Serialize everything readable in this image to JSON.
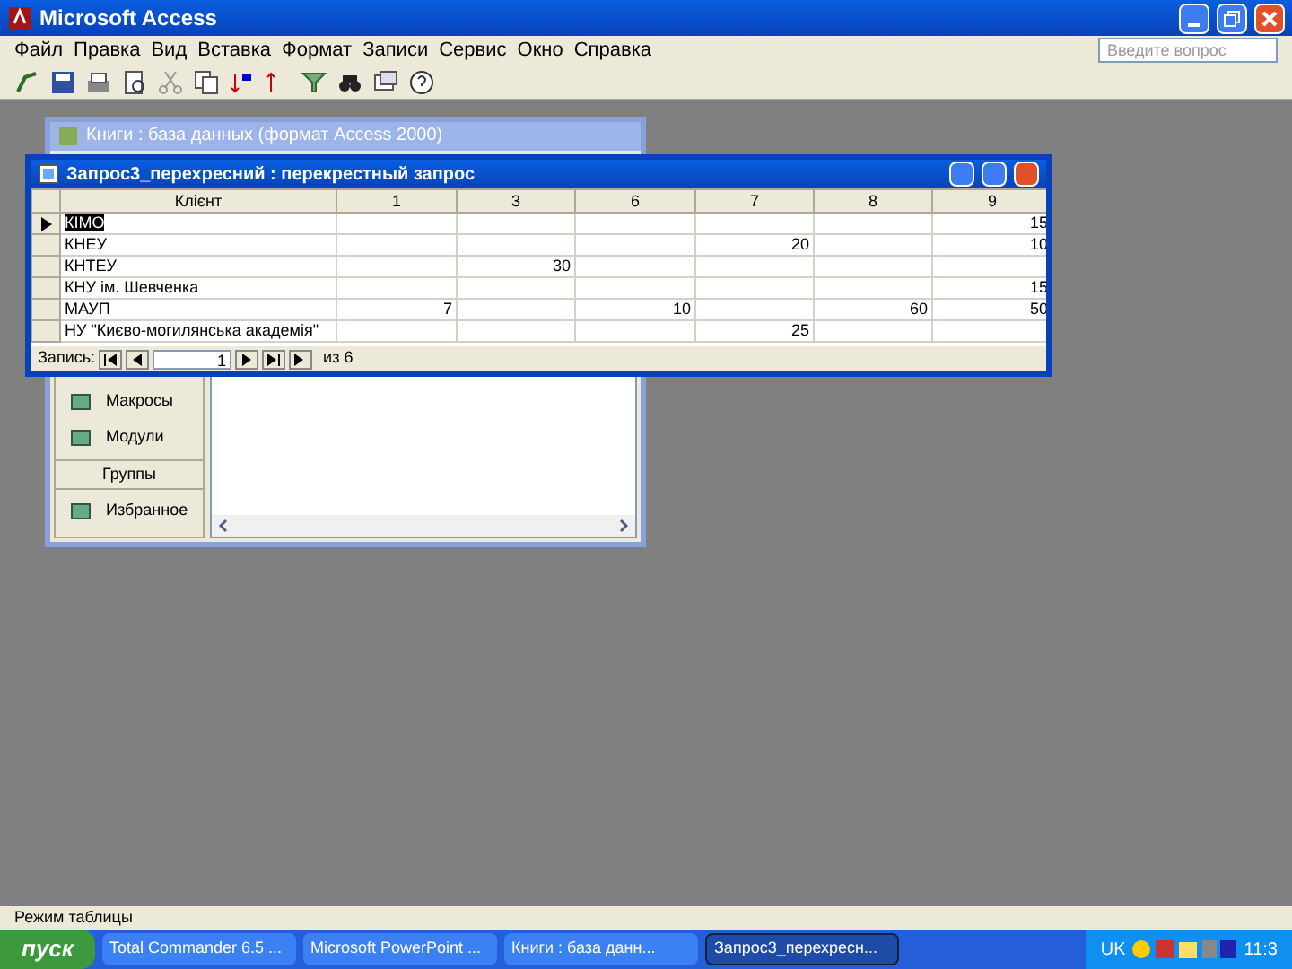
{
  "app_window": {
    "title": "Microsoft Access"
  },
  "menu": [
    {
      "label": "Файл"
    },
    {
      "label": "Правка"
    },
    {
      "label": "Вид"
    },
    {
      "label": "Вставка"
    },
    {
      "label": "Формат"
    },
    {
      "label": "Записи"
    },
    {
      "label": "Сервис"
    },
    {
      "label": "Окно"
    },
    {
      "label": "Справка"
    }
  ],
  "help_box": {
    "placeholder": "Введите вопрос"
  },
  "database_window": {
    "title": "Книги : база данных (формат Access 2000)",
    "objects": [
      {
        "kind": "item",
        "label": "Макросы"
      },
      {
        "kind": "item",
        "label": "Модули"
      },
      {
        "kind": "header",
        "label": "Группы"
      },
      {
        "kind": "item",
        "label": "Избранное"
      }
    ]
  },
  "query_window": {
    "title": "Запрос3_перехресний : перекрестный запрос",
    "columns": [
      "Клієнт",
      "1",
      "3",
      "6",
      "7",
      "8",
      "9"
    ],
    "rows": [
      {
        "current": true,
        "cells": [
          "КІМО",
          "",
          "",
          "",
          "",
          "",
          "15"
        ]
      },
      {
        "current": false,
        "cells": [
          "КНЕУ",
          "",
          "",
          "",
          "20",
          "",
          "10"
        ]
      },
      {
        "current": false,
        "cells": [
          "КНТЕУ",
          "",
          "30",
          "",
          "",
          "",
          ""
        ]
      },
      {
        "current": false,
        "cells": [
          "КНУ ім. Шевченка",
          "",
          "",
          "",
          "",
          "",
          "15"
        ]
      },
      {
        "current": false,
        "cells": [
          "МАУП",
          "7",
          "",
          "10",
          "",
          "60",
          "50"
        ]
      },
      {
        "current": false,
        "cells": [
          "НУ \"Києво-могилянська академія\"",
          "",
          "",
          "",
          "25",
          "",
          ""
        ]
      }
    ],
    "navigator": {
      "label": "Запись:",
      "record": "1",
      "total": "из 6"
    }
  },
  "status_bar": {
    "text": "Режим таблицы"
  },
  "taskbar": {
    "start": "пуск",
    "tasks": [
      {
        "label": "Total Commander 6.5 ...",
        "selected": false
      },
      {
        "label": "Microsoft PowerPoint ...",
        "selected": false
      },
      {
        "label": "Книги : база данн...",
        "selected": false
      },
      {
        "label": "Запрос3_перехресн...",
        "selected": true
      }
    ],
    "language": "UK",
    "clock": "11:3"
  }
}
